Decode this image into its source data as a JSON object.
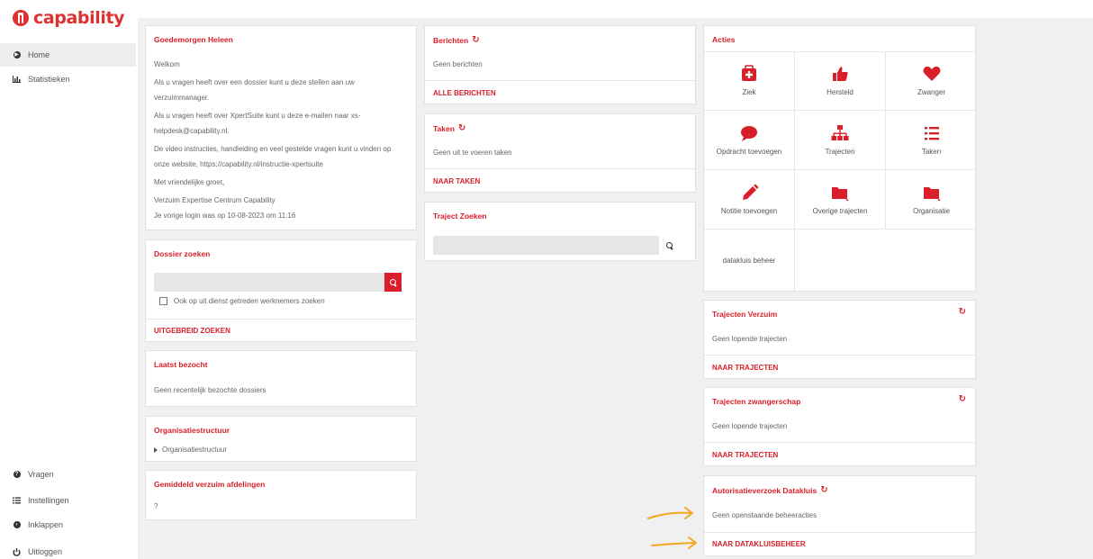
{
  "brand": {
    "name": "capability",
    "color": "#e03131"
  },
  "sidebar": {
    "top_items": [
      {
        "label": "Home",
        "icon": "play-circle-icon"
      },
      {
        "label": "Statistieken",
        "icon": "bar-chart-icon"
      }
    ],
    "bottom_items": [
      {
        "label": "Vragen",
        "icon": "question-circle-icon"
      },
      {
        "label": "Instellingen",
        "icon": "list-icon"
      },
      {
        "label": "Inklappen",
        "icon": "chevron-left-circle-icon"
      },
      {
        "label": "Uitloggen",
        "icon": "power-icon"
      }
    ]
  },
  "welcome": {
    "title": "Goedemorgen Heleen",
    "line1": "Welkom",
    "line2a": "Als u vragen heeft over een dossier kunt u deze stellen aan uw",
    "line2b": "verzuimmanager.",
    "line3a": "Als u vragen heeft over XpertSuite kunt u deze e-mailen naar xs-",
    "line3b": "helpdesk@capability.nl.",
    "line4a": "De video instructies, handleiding en veel gestelde vragen kunt u vinden op",
    "line4b": "onze website, https://capability.nl/instructie-xpertsuite",
    "line5": "Met vriendelijke groet,",
    "line6": "Verzuim Expertise Centrum Capability",
    "line7": "Je vorige login was op 10-08-2023 om 11:16"
  },
  "dossier": {
    "title": "Dossier zoeken",
    "checkbox_label": "Ook op uit dienst getreden werknemers zoeken",
    "link": "UITGEBREID ZOEKEN"
  },
  "recent": {
    "title": "Laatst bezocht",
    "text": "Geen recentelijk bezochte dossiers"
  },
  "org": {
    "title": "Organisatiestructuur",
    "item": "Organisatiestructuur"
  },
  "avg": {
    "title": "Gemiddeld verzuim afdelingen",
    "text": "?"
  },
  "berichten": {
    "title": "Berichten",
    "text": "Geen berichten",
    "link": "ALLE BERICHTEN"
  },
  "taken": {
    "title": "Taken",
    "text": "Geen uit te voeren taken",
    "link": "NAAR TAKEN"
  },
  "traject_zoeken": {
    "title": "Traject Zoeken"
  },
  "acties": {
    "title": "Acties",
    "items": [
      {
        "label": "Ziek",
        "icon": "medkit-icon"
      },
      {
        "label": "Hersteld",
        "icon": "thumbs-up-icon"
      },
      {
        "label": "Zwanger",
        "icon": "heart-icon"
      },
      {
        "label": "Opdracht toevoegen",
        "icon": "speech-bubble-icon"
      },
      {
        "label": "Trajecten",
        "icon": "sitemap-icon"
      },
      {
        "label": "Taken",
        "icon": "list-icon"
      },
      {
        "label": "Notitie toevoegen",
        "icon": "pencil-icon"
      },
      {
        "label": "Overige trajecten",
        "icon": "folder-dropdown-icon"
      },
      {
        "label": "Organisatie",
        "icon": "folder-dropdown-icon"
      },
      {
        "label": "datakluis beheer",
        "icon": ""
      }
    ]
  },
  "trajecten_verzuim": {
    "title": "Trajecten Verzuim",
    "text": "Geen lopende trajecten",
    "link": "NAAR TRAJECTEN"
  },
  "trajecten_zwanger": {
    "title": "Trajecten zwangerschap",
    "text": "Geen lopende trajecten",
    "link": "NAAR TRAJECTEN"
  },
  "autorisatie": {
    "title": "Autorisatieverzoek Datakluis",
    "text": "Geen openstaande beheeracties",
    "link": "NAAR DATAKLUISBEHEER"
  },
  "colors": {
    "accent": "#d9202a",
    "annotation_arrow": "#f5a623"
  }
}
